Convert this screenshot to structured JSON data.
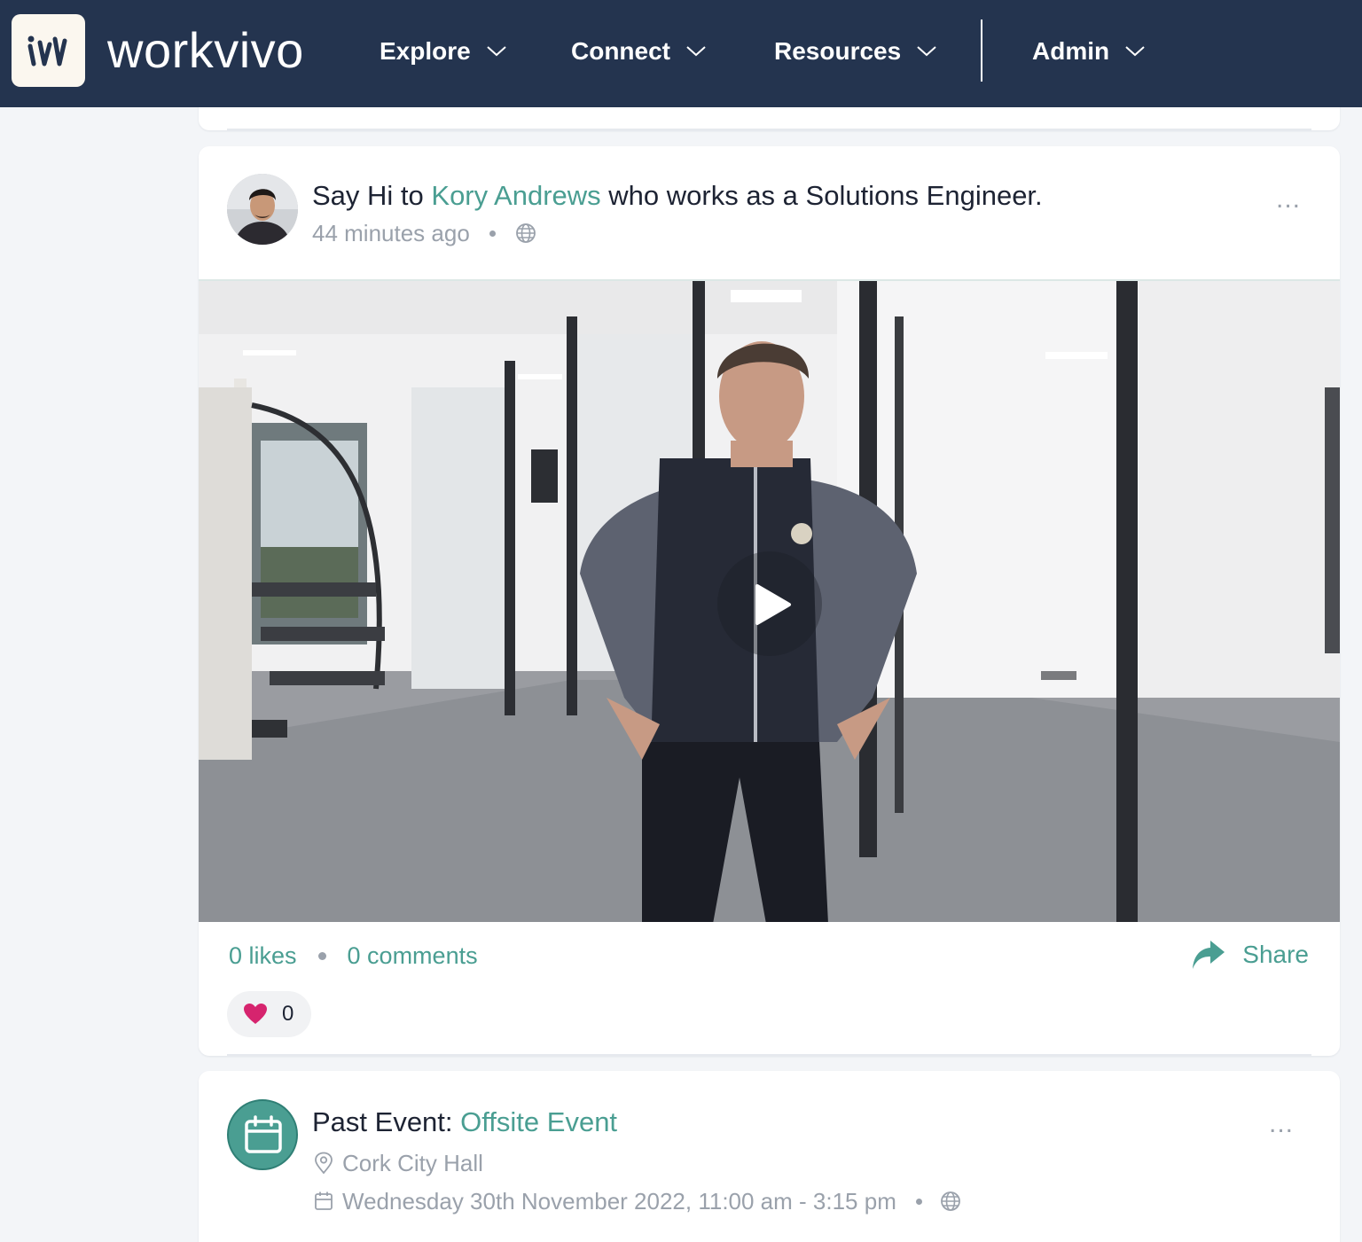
{
  "app": {
    "brand": "workvivo"
  },
  "nav": {
    "items": [
      {
        "label": "Explore"
      },
      {
        "label": "Connect"
      },
      {
        "label": "Resources"
      },
      {
        "label": "Admin"
      }
    ]
  },
  "post": {
    "headline_prefix": "Say Hi to ",
    "person_name": "Kory Andrews",
    "headline_suffix": " who works as a Solutions Engineer.",
    "time": "44 minutes ago",
    "likes": "0 likes",
    "comments": "0 comments",
    "share_label": "Share",
    "reaction_count": "0",
    "more": "..."
  },
  "event": {
    "prefix": "Past Event: ",
    "title": "Offsite Event",
    "location": "Cork City Hall",
    "datetime": "Wednesday 30th November 2022, 11:00 am - 3:15 pm",
    "more": "..."
  },
  "colors": {
    "nav_bg": "#24344f",
    "accent": "#4a9e92",
    "muted": "#9aa1ab",
    "heart": "#d6246e"
  }
}
